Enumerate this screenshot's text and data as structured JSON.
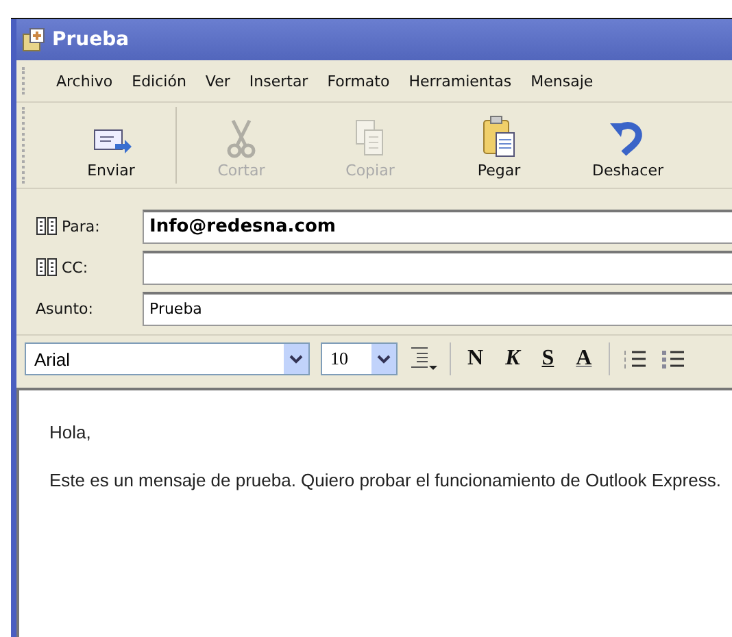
{
  "window": {
    "title": "Prueba"
  },
  "menu": [
    "Archivo",
    "Edición",
    "Ver",
    "Insertar",
    "Formato",
    "Herramientas",
    "Mensaje"
  ],
  "toolbar": [
    {
      "kind": "send",
      "label": "Enviar",
      "disabled": false
    },
    {
      "kind": "cut",
      "label": "Cortar",
      "disabled": true
    },
    {
      "kind": "copy",
      "label": "Copiar",
      "disabled": true
    },
    {
      "kind": "paste",
      "label": "Pegar",
      "disabled": false
    },
    {
      "kind": "undo",
      "label": "Deshacer",
      "disabled": false
    }
  ],
  "header": [
    {
      "kind": "book",
      "label": "Para:",
      "value": "Info@redesna.com",
      "bold": true
    },
    {
      "kind": "book",
      "label": "CC:"
    },
    {
      "kind": "plain",
      "label": "Asunto:",
      "value": "Prueba",
      "bold": false
    }
  ],
  "format": {
    "font": "Arial",
    "size": "10",
    "buttons": [
      {
        "kind": "bold",
        "label": "N"
      },
      {
        "kind": "italic",
        "label": "K"
      },
      {
        "kind": "underline",
        "label": "S"
      },
      {
        "kind": "color",
        "label": "A"
      }
    ]
  },
  "body": [
    "Hola,",
    "Este es un mensaje de prueba. Quiero probar el funcionamiento de Outlook Express."
  ]
}
